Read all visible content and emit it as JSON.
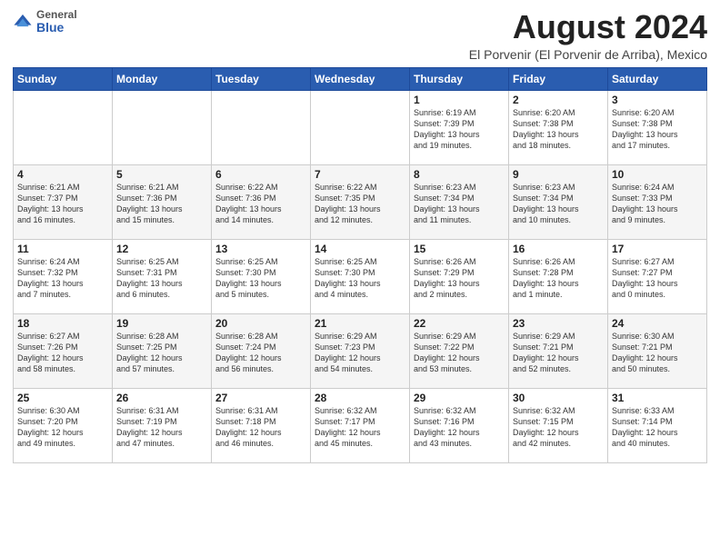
{
  "logo": {
    "general": "General",
    "blue": "Blue"
  },
  "header": {
    "month": "August 2024",
    "location": "El Porvenir (El Porvenir de Arriba), Mexico"
  },
  "weekdays": [
    "Sunday",
    "Monday",
    "Tuesday",
    "Wednesday",
    "Thursday",
    "Friday",
    "Saturday"
  ],
  "weeks": [
    [
      {
        "day": "",
        "info": ""
      },
      {
        "day": "",
        "info": ""
      },
      {
        "day": "",
        "info": ""
      },
      {
        "day": "",
        "info": ""
      },
      {
        "day": "1",
        "info": "Sunrise: 6:19 AM\nSunset: 7:39 PM\nDaylight: 13 hours\nand 19 minutes."
      },
      {
        "day": "2",
        "info": "Sunrise: 6:20 AM\nSunset: 7:38 PM\nDaylight: 13 hours\nand 18 minutes."
      },
      {
        "day": "3",
        "info": "Sunrise: 6:20 AM\nSunset: 7:38 PM\nDaylight: 13 hours\nand 17 minutes."
      }
    ],
    [
      {
        "day": "4",
        "info": "Sunrise: 6:21 AM\nSunset: 7:37 PM\nDaylight: 13 hours\nand 16 minutes."
      },
      {
        "day": "5",
        "info": "Sunrise: 6:21 AM\nSunset: 7:36 PM\nDaylight: 13 hours\nand 15 minutes."
      },
      {
        "day": "6",
        "info": "Sunrise: 6:22 AM\nSunset: 7:36 PM\nDaylight: 13 hours\nand 14 minutes."
      },
      {
        "day": "7",
        "info": "Sunrise: 6:22 AM\nSunset: 7:35 PM\nDaylight: 13 hours\nand 12 minutes."
      },
      {
        "day": "8",
        "info": "Sunrise: 6:23 AM\nSunset: 7:34 PM\nDaylight: 13 hours\nand 11 minutes."
      },
      {
        "day": "9",
        "info": "Sunrise: 6:23 AM\nSunset: 7:34 PM\nDaylight: 13 hours\nand 10 minutes."
      },
      {
        "day": "10",
        "info": "Sunrise: 6:24 AM\nSunset: 7:33 PM\nDaylight: 13 hours\nand 9 minutes."
      }
    ],
    [
      {
        "day": "11",
        "info": "Sunrise: 6:24 AM\nSunset: 7:32 PM\nDaylight: 13 hours\nand 7 minutes."
      },
      {
        "day": "12",
        "info": "Sunrise: 6:25 AM\nSunset: 7:31 PM\nDaylight: 13 hours\nand 6 minutes."
      },
      {
        "day": "13",
        "info": "Sunrise: 6:25 AM\nSunset: 7:30 PM\nDaylight: 13 hours\nand 5 minutes."
      },
      {
        "day": "14",
        "info": "Sunrise: 6:25 AM\nSunset: 7:30 PM\nDaylight: 13 hours\nand 4 minutes."
      },
      {
        "day": "15",
        "info": "Sunrise: 6:26 AM\nSunset: 7:29 PM\nDaylight: 13 hours\nand 2 minutes."
      },
      {
        "day": "16",
        "info": "Sunrise: 6:26 AM\nSunset: 7:28 PM\nDaylight: 13 hours\nand 1 minute."
      },
      {
        "day": "17",
        "info": "Sunrise: 6:27 AM\nSunset: 7:27 PM\nDaylight: 13 hours\nand 0 minutes."
      }
    ],
    [
      {
        "day": "18",
        "info": "Sunrise: 6:27 AM\nSunset: 7:26 PM\nDaylight: 12 hours\nand 58 minutes."
      },
      {
        "day": "19",
        "info": "Sunrise: 6:28 AM\nSunset: 7:25 PM\nDaylight: 12 hours\nand 57 minutes."
      },
      {
        "day": "20",
        "info": "Sunrise: 6:28 AM\nSunset: 7:24 PM\nDaylight: 12 hours\nand 56 minutes."
      },
      {
        "day": "21",
        "info": "Sunrise: 6:29 AM\nSunset: 7:23 PM\nDaylight: 12 hours\nand 54 minutes."
      },
      {
        "day": "22",
        "info": "Sunrise: 6:29 AM\nSunset: 7:22 PM\nDaylight: 12 hours\nand 53 minutes."
      },
      {
        "day": "23",
        "info": "Sunrise: 6:29 AM\nSunset: 7:21 PM\nDaylight: 12 hours\nand 52 minutes."
      },
      {
        "day": "24",
        "info": "Sunrise: 6:30 AM\nSunset: 7:21 PM\nDaylight: 12 hours\nand 50 minutes."
      }
    ],
    [
      {
        "day": "25",
        "info": "Sunrise: 6:30 AM\nSunset: 7:20 PM\nDaylight: 12 hours\nand 49 minutes."
      },
      {
        "day": "26",
        "info": "Sunrise: 6:31 AM\nSunset: 7:19 PM\nDaylight: 12 hours\nand 47 minutes."
      },
      {
        "day": "27",
        "info": "Sunrise: 6:31 AM\nSunset: 7:18 PM\nDaylight: 12 hours\nand 46 minutes."
      },
      {
        "day": "28",
        "info": "Sunrise: 6:32 AM\nSunset: 7:17 PM\nDaylight: 12 hours\nand 45 minutes."
      },
      {
        "day": "29",
        "info": "Sunrise: 6:32 AM\nSunset: 7:16 PM\nDaylight: 12 hours\nand 43 minutes."
      },
      {
        "day": "30",
        "info": "Sunrise: 6:32 AM\nSunset: 7:15 PM\nDaylight: 12 hours\nand 42 minutes."
      },
      {
        "day": "31",
        "info": "Sunrise: 6:33 AM\nSunset: 7:14 PM\nDaylight: 12 hours\nand 40 minutes."
      }
    ]
  ]
}
